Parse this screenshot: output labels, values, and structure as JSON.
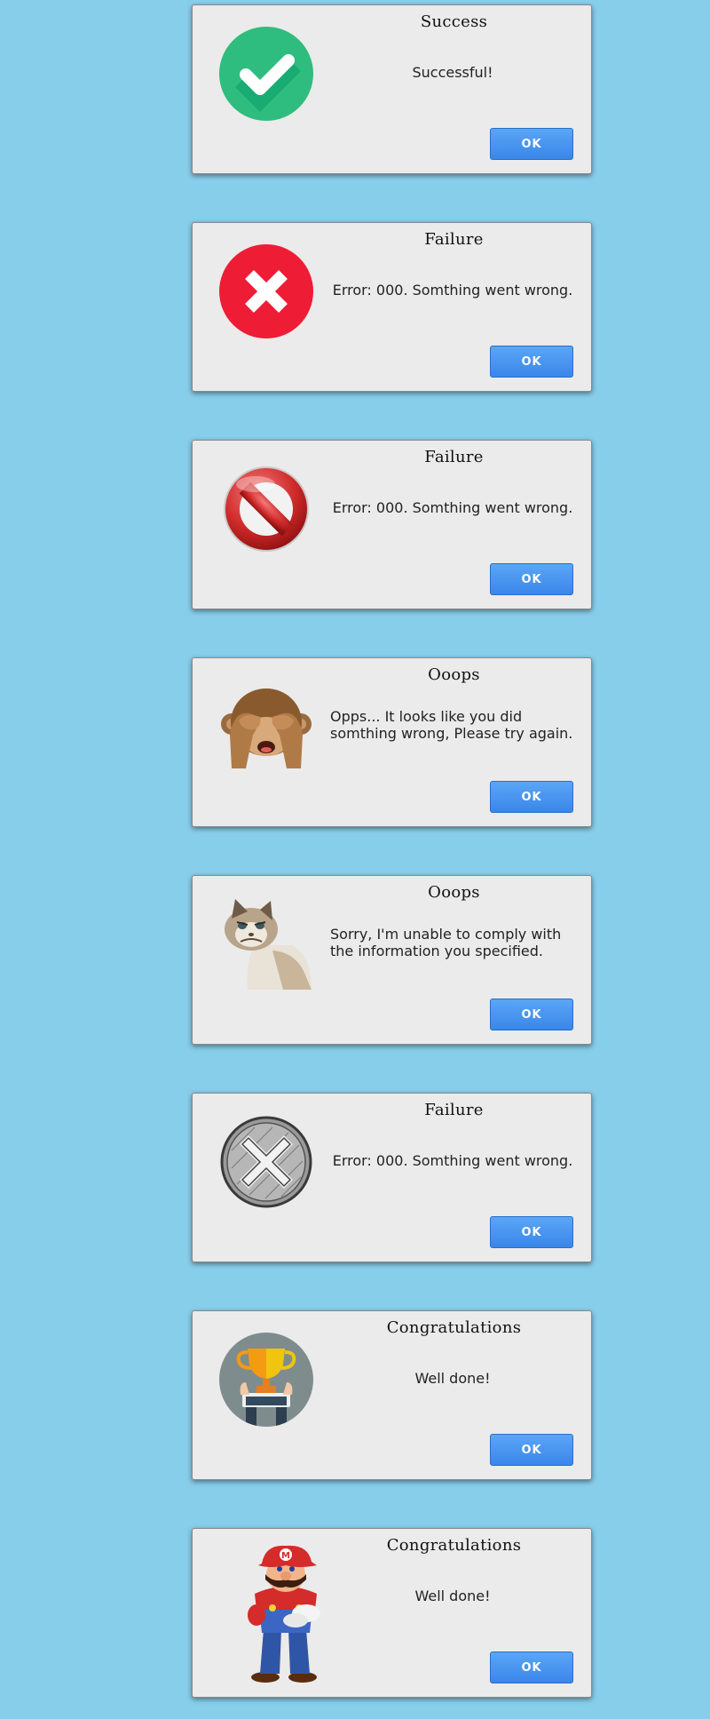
{
  "dialogs": [
    {
      "title": "Success",
      "message": "Successful!",
      "button": "OK",
      "icon": "check-circle-icon"
    },
    {
      "title": "Failure",
      "message": "Error: 000. Somthing went wrong.",
      "button": "OK",
      "icon": "red-x-circle-icon"
    },
    {
      "title": "Failure",
      "message": "Error: 000. Somthing went wrong.",
      "button": "OK",
      "icon": "no-entry-icon"
    },
    {
      "title": "Ooops",
      "message": "Opps... It looks like you did somthing wrong, Please try again.",
      "button": "OK",
      "icon": "see-no-evil-monkey-icon"
    },
    {
      "title": "Ooops",
      "message": "Sorry, I'm unable to comply with the information you specified.",
      "button": "OK",
      "icon": "grumpy-cat-icon"
    },
    {
      "title": "Failure",
      "message": "Error: 000. Somthing went wrong.",
      "button": "OK",
      "icon": "sketch-x-circle-icon"
    },
    {
      "title": "Congratulations",
      "message": "Well done!",
      "button": "OK",
      "icon": "trophy-icon"
    },
    {
      "title": "Congratulations",
      "message": "Well done!",
      "button": "OK",
      "icon": "mario-icon"
    }
  ],
  "colors": {
    "background": "#87CEEB",
    "dialog": "#EBEBEB",
    "button": "#3A86EA",
    "success": "#2EBD7E",
    "error": "#EF1C36"
  }
}
